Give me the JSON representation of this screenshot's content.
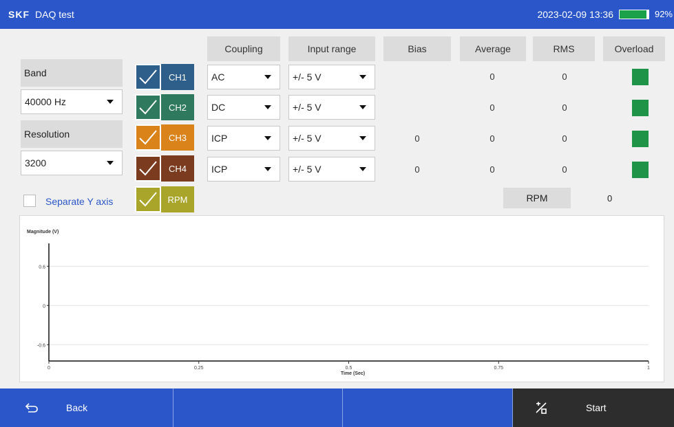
{
  "header": {
    "logo": "SKF",
    "title": "DAQ test",
    "datetime": "2023-02-09 13:36",
    "battery_pct": "92%",
    "battery_level": 0.92
  },
  "columns": [
    "Coupling",
    "Input range",
    "Bias",
    "Average",
    "RMS",
    "Overload"
  ],
  "settings": {
    "band_label": "Band",
    "band_value": "40000 Hz",
    "resolution_label": "Resolution",
    "resolution_value": "3200",
    "separate_y_label": "Separate Y axis"
  },
  "channels": [
    {
      "name": "CH1",
      "color": "#2e5f8a",
      "coupling": "AC",
      "range": "+/- 5 V",
      "bias": "",
      "average": "0",
      "rms": "0"
    },
    {
      "name": "CH2",
      "color": "#2f7a5e",
      "coupling": "DC",
      "range": "+/- 5 V",
      "bias": "",
      "average": "0",
      "rms": "0"
    },
    {
      "name": "CH3",
      "color": "#d9831a",
      "coupling": "ICP",
      "range": "+/- 5 V",
      "bias": "0",
      "average": "0",
      "rms": "0"
    },
    {
      "name": "CH4",
      "color": "#7a3b1f",
      "coupling": "ICP",
      "range": "+/- 5 V",
      "bias": "0",
      "average": "0",
      "rms": "0"
    }
  ],
  "rpm": {
    "name": "RPM",
    "color": "#a8a52a",
    "label": "RPM",
    "value": "0"
  },
  "chart_data": {
    "type": "line",
    "title": "",
    "ylabel": "Magnitude (V)",
    "xlabel": "Time (Sec)",
    "xlim": [
      0,
      1
    ],
    "ylim": [
      -0.85,
      0.95
    ],
    "x_ticks": [
      "0",
      "0.25",
      "0.5",
      "0.75",
      "1"
    ],
    "y_ticks": [
      "0.6",
      "0",
      "-0.6"
    ],
    "y_tick_values": [
      0.6,
      0,
      -0.6
    ],
    "x_tick_values": [
      0,
      0.25,
      0.5,
      0.75,
      1
    ],
    "grid": true,
    "series": []
  },
  "footer": {
    "back_label": "Back",
    "start_label": "Start"
  }
}
